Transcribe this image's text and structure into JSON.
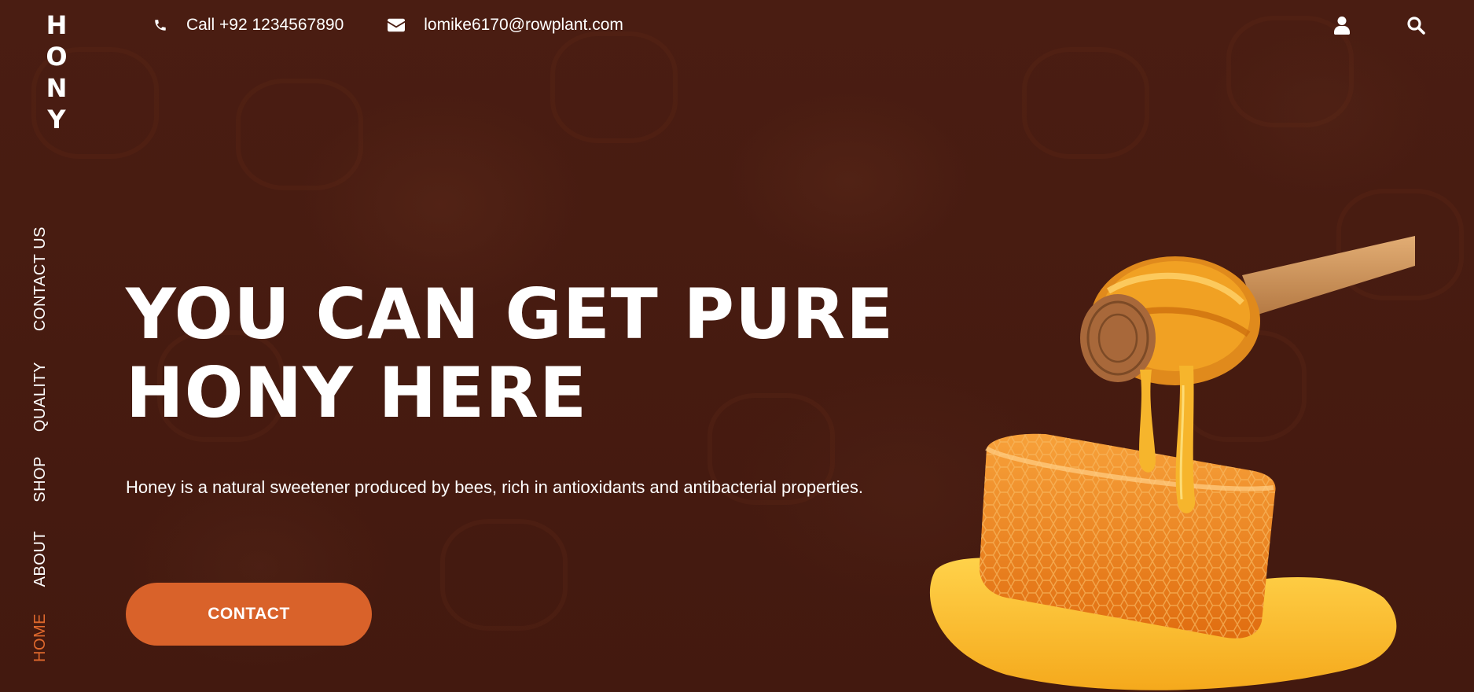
{
  "brand": {
    "letters": [
      "H",
      "O",
      "N",
      "Y"
    ]
  },
  "topbar": {
    "phone_label": "Call +92 1234567890",
    "email_label": "lomike6170@rowplant.com",
    "phone_icon": "phone-icon",
    "email_icon": "envelope-icon",
    "user_icon": "user-icon",
    "search_icon": "search-icon"
  },
  "sidenav": {
    "items": [
      {
        "label": "CONTACT US",
        "active": false
      },
      {
        "label": "QUALITY",
        "active": false
      },
      {
        "label": "SHOP",
        "active": false
      },
      {
        "label": "ABOUT",
        "active": false
      },
      {
        "label": "HOME",
        "active": true
      }
    ]
  },
  "hero": {
    "headline_line1": "YOU CAN GET PURE",
    "headline_line2": "HONY HERE",
    "description": "Honey is a natural sweetener produced by bees, rich in antioxidants and antibacterial properties.",
    "cta_label": "CONTACT"
  },
  "colors": {
    "background": "#4a1e12",
    "accent": "#d9622a",
    "active_nav": "#e0692d",
    "text": "#ffffff"
  }
}
